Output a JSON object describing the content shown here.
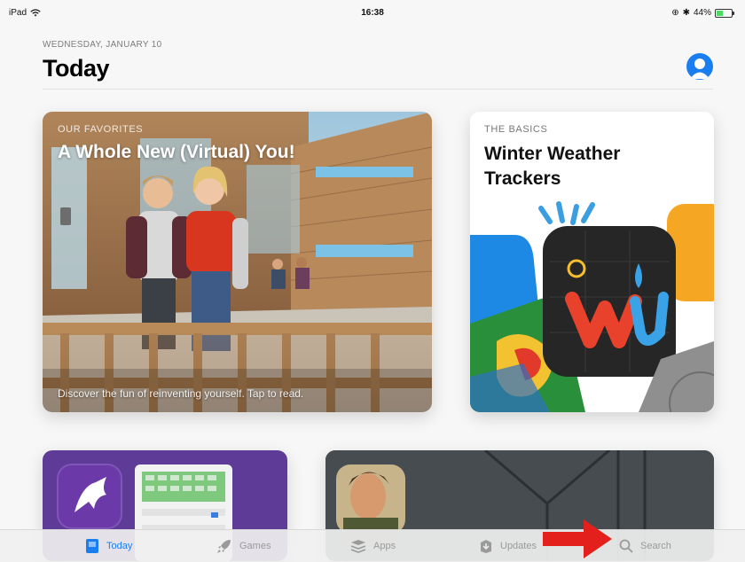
{
  "status_bar": {
    "device": "iPad",
    "time": "16:38",
    "battery": "44%",
    "battery_level": 0.44
  },
  "header": {
    "date": "WEDNESDAY, JANUARY 10",
    "title": "Today"
  },
  "cards": [
    {
      "eyebrow": "OUR FAVORITES",
      "title": "A Whole New (Virtual) You!",
      "caption": "Discover the fun of reinventing yourself. Tap to read."
    },
    {
      "eyebrow": "THE BASICS",
      "title": "Winter Weather Trackers"
    }
  ],
  "tabs": [
    {
      "label": "Today",
      "icon": "today-icon",
      "active": true
    },
    {
      "label": "Games",
      "icon": "rocket-icon",
      "active": false
    },
    {
      "label": "Apps",
      "icon": "apps-stack-icon",
      "active": false
    },
    {
      "label": "Updates",
      "icon": "updates-icon",
      "active": false
    },
    {
      "label": "Search",
      "icon": "search-icon",
      "active": false
    }
  ],
  "colors": {
    "accent": "#1a7ef0",
    "annotation_arrow": "#e3201b"
  }
}
